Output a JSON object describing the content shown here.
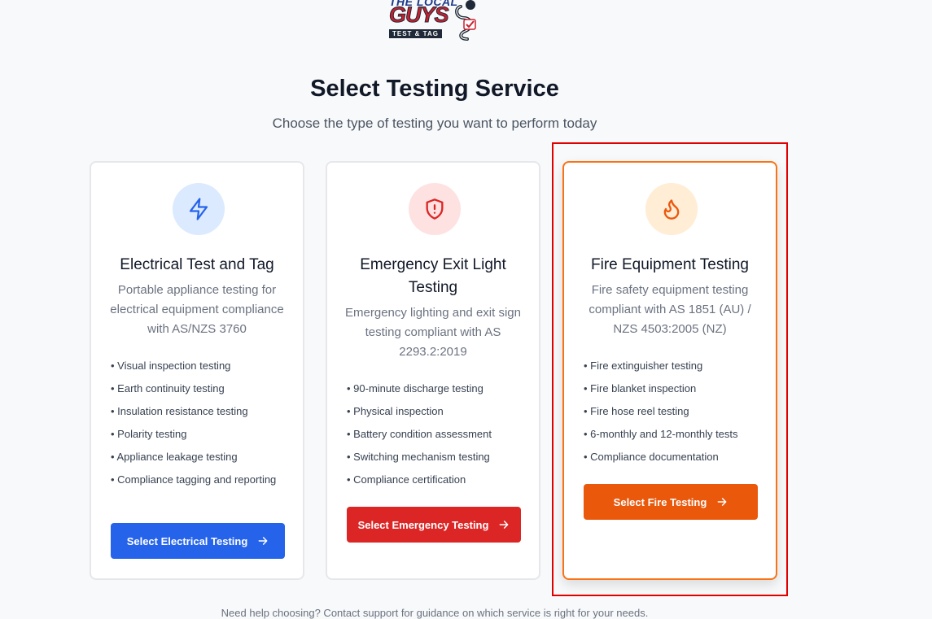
{
  "logo": {
    "top_text": "THE LOCAL",
    "main_text": "GUYS",
    "sub_text": "TEST & TAG"
  },
  "header": {
    "title": "Select Testing Service",
    "subtitle": "Choose the type of testing you want to perform today"
  },
  "cards": [
    {
      "icon": "lightning-icon",
      "title": "Electrical Test and Tag",
      "description": "Portable appliance testing for electrical equipment compliance with AS/NZS 3760",
      "features": [
        "• Visual inspection testing",
        "• Earth continuity testing",
        "• Insulation resistance testing",
        "• Polarity testing",
        "• Appliance leakage testing",
        "• Compliance tagging and reporting"
      ],
      "button_label": "Select Electrical Testing",
      "accent": "#2563eb"
    },
    {
      "icon": "shield-alert-icon",
      "title": "Emergency Exit Light Testing",
      "description": "Emergency lighting and exit sign testing compliant with AS 2293.2:2019",
      "features": [
        "• 90-minute discharge testing",
        "• Physical inspection",
        "• Battery condition assessment",
        "• Switching mechanism testing",
        "• Compliance certification"
      ],
      "button_label": "Select Emergency Testing",
      "accent": "#dc2626"
    },
    {
      "icon": "flame-icon",
      "title": "Fire Equipment Testing",
      "description": "Fire safety equipment testing compliant with AS 1851 (AU) / NZS 4503:2005 (NZ)",
      "features": [
        "• Fire extinguisher testing",
        "• Fire blanket inspection",
        "• Fire hose reel testing",
        "• 6-monthly and 12-monthly tests",
        "• Compliance documentation"
      ],
      "button_label": "Select Fire Testing",
      "accent": "#ea580c"
    }
  ],
  "footer": {
    "help_text": "Need help choosing? Contact support for guidance on which service is right for your needs."
  }
}
